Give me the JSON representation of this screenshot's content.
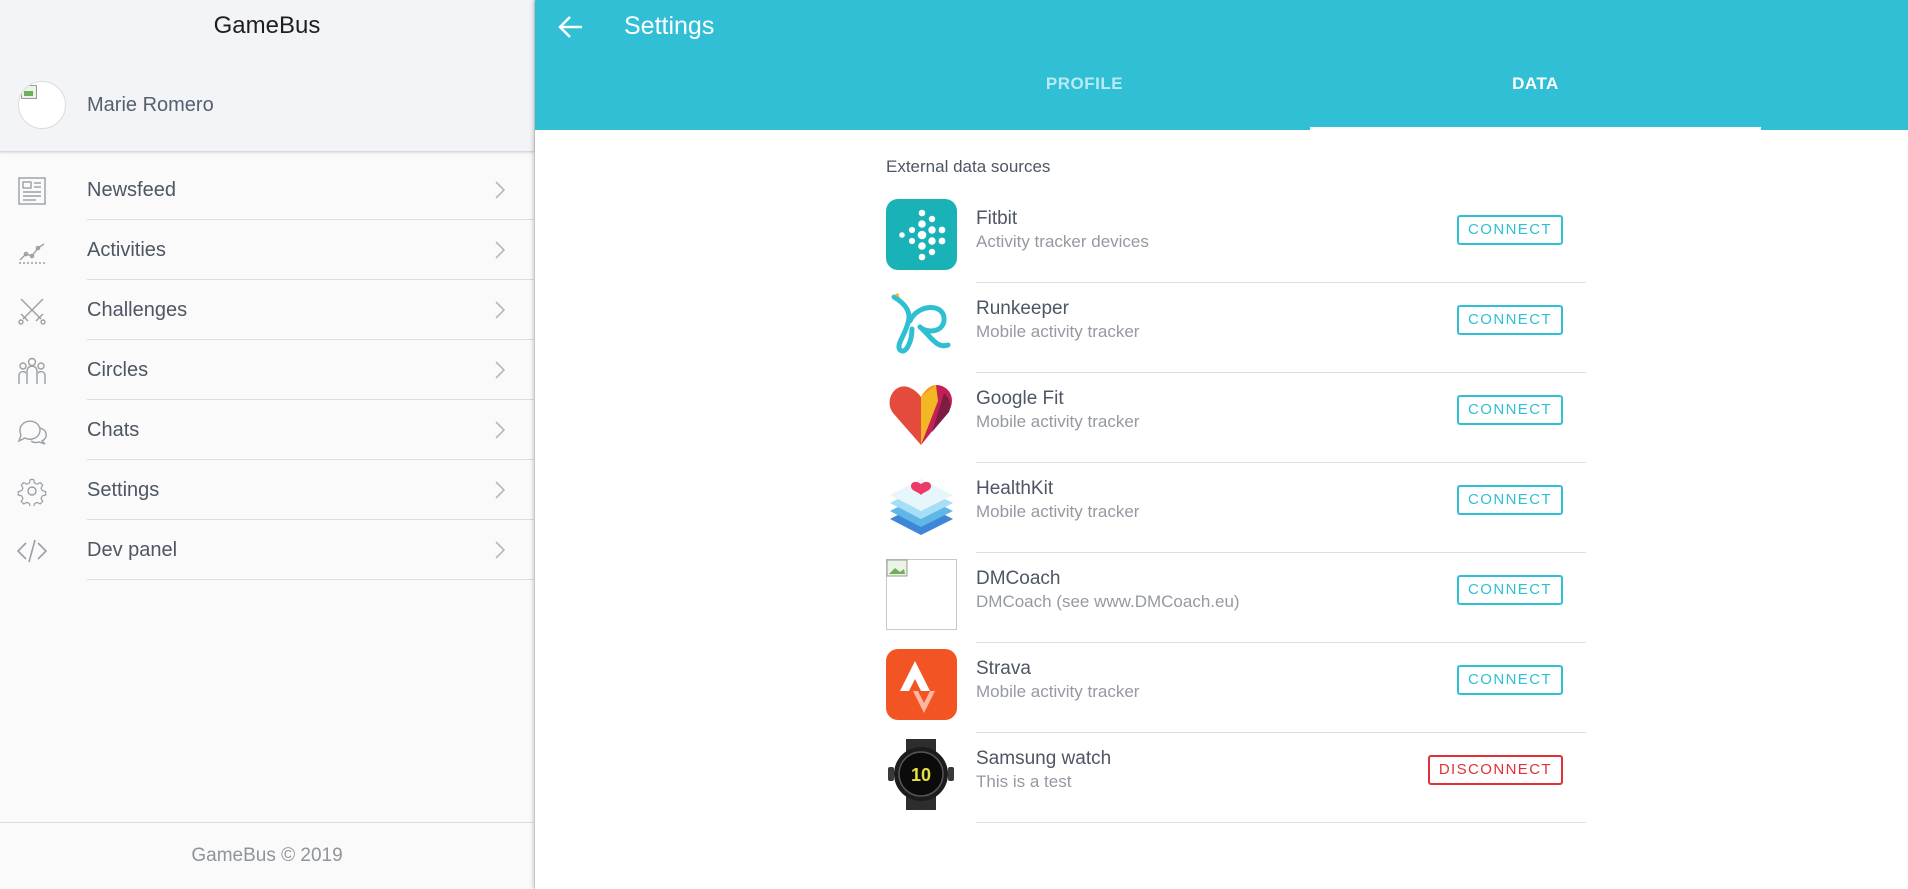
{
  "app": {
    "name": "GameBus",
    "footer": "GameBus © 2019"
  },
  "user": {
    "name": "Marie Romero"
  },
  "nav": [
    {
      "label": "Newsfeed",
      "icon": "newspaper-icon"
    },
    {
      "label": "Activities",
      "icon": "line-chart-icon"
    },
    {
      "label": "Challenges",
      "icon": "crossed-swords-icon"
    },
    {
      "label": "Circles",
      "icon": "people-group-icon"
    },
    {
      "label": "Chats",
      "icon": "chat-bubbles-icon"
    },
    {
      "label": "Settings",
      "icon": "gear-icon"
    },
    {
      "label": "Dev panel",
      "icon": "code-brackets-icon"
    }
  ],
  "header": {
    "title": "Settings",
    "tabs": [
      "PROFILE",
      "DATA"
    ],
    "active_tab": "DATA",
    "accent_color": "#30bfd5"
  },
  "data_sources": {
    "section_title": "External data sources",
    "items": [
      {
        "name": "Fitbit",
        "description": "Activity tracker devices",
        "action": "CONNECT",
        "icon": "fitbit-logo"
      },
      {
        "name": "Runkeeper",
        "description": "Mobile activity tracker",
        "action": "CONNECT",
        "icon": "runkeeper-logo"
      },
      {
        "name": "Google Fit",
        "description": "Mobile activity tracker",
        "action": "CONNECT",
        "icon": "google-fit-logo"
      },
      {
        "name": "HealthKit",
        "description": "Mobile activity tracker",
        "action": "CONNECT",
        "icon": "healthkit-logo"
      },
      {
        "name": "DMCoach",
        "description": "DMCoach (see www.DMCoach.eu)",
        "action": "CONNECT",
        "icon": "broken-image-icon"
      },
      {
        "name": "Strava",
        "description": "Mobile activity tracker",
        "action": "CONNECT",
        "icon": "strava-logo"
      },
      {
        "name": "Samsung watch",
        "description": "This is a test",
        "action": "DISCONNECT",
        "icon": "samsung-watch-image",
        "action_color": "#e0313a"
      }
    ]
  }
}
